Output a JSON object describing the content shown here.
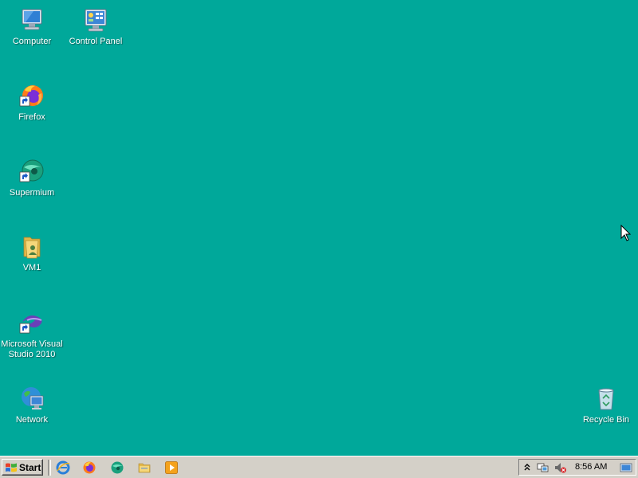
{
  "desktop": {
    "background": "#00a89a",
    "icons": [
      {
        "label": "Computer",
        "icon": "computer-icon"
      },
      {
        "label": "Control Panel",
        "icon": "control-panel-icon"
      },
      {
        "label": "Firefox",
        "icon": "firefox-icon"
      },
      {
        "label": "Supermium",
        "icon": "supermium-icon"
      },
      {
        "label": "VM1",
        "icon": "folder-icon"
      },
      {
        "label": "Microsoft Visual\nStudio 2010",
        "icon": "visual-studio-icon"
      },
      {
        "label": "Network",
        "icon": "network-icon"
      },
      {
        "label": "Recycle Bin",
        "icon": "recycle-bin-icon"
      }
    ]
  },
  "taskbar": {
    "start_label": "Start",
    "quick_launch": [
      "internet-explorer-icon",
      "firefox-icon",
      "supermium-icon",
      "file-explorer-icon",
      "media-player-icon"
    ],
    "tray": {
      "icons": [
        "show-hidden-icon",
        "network-status-icon",
        "volume-muted-icon",
        "show-desktop-icon"
      ],
      "clock": "8:56 AM"
    }
  }
}
